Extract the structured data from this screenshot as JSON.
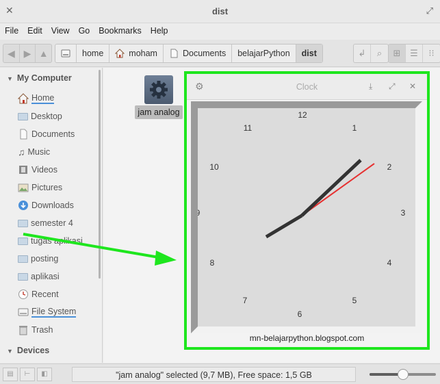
{
  "window": {
    "title": "dist"
  },
  "menu": [
    "File",
    "Edit",
    "View",
    "Go",
    "Bookmarks",
    "Help"
  ],
  "breadcrumbs": [
    "home",
    "moham",
    "Documents",
    "belajarPython",
    "dist"
  ],
  "sidebar": {
    "section_computer": "My Computer",
    "items": [
      "Home",
      "Desktop",
      "Documents",
      "Music",
      "Videos",
      "Pictures",
      "Downloads",
      "semester 4",
      "tugas aplikasi",
      "posting",
      "aplikasi",
      "Recent",
      "File System",
      "Trash"
    ],
    "section_devices": "Devices"
  },
  "file": {
    "name": "jam analog"
  },
  "status": {
    "text": "\"jam analog\" selected (9,7 MB), Free space: 1,5 GB",
    "zoom_level": 0.5
  },
  "clock_window": {
    "title": "Clock",
    "numbers": [
      "12",
      "1",
      "2",
      "3",
      "4",
      "5",
      "6",
      "7",
      "8",
      "9",
      "10",
      "11"
    ],
    "footer": "mn-belajarpython.blogspot.com",
    "hour_hand_color": "#333333",
    "second_hand_color": "#e63232"
  },
  "colors": {
    "highlight_border": "#1ee61e",
    "arrow": "#1ee61e",
    "link_underline": "#4a90d9"
  }
}
